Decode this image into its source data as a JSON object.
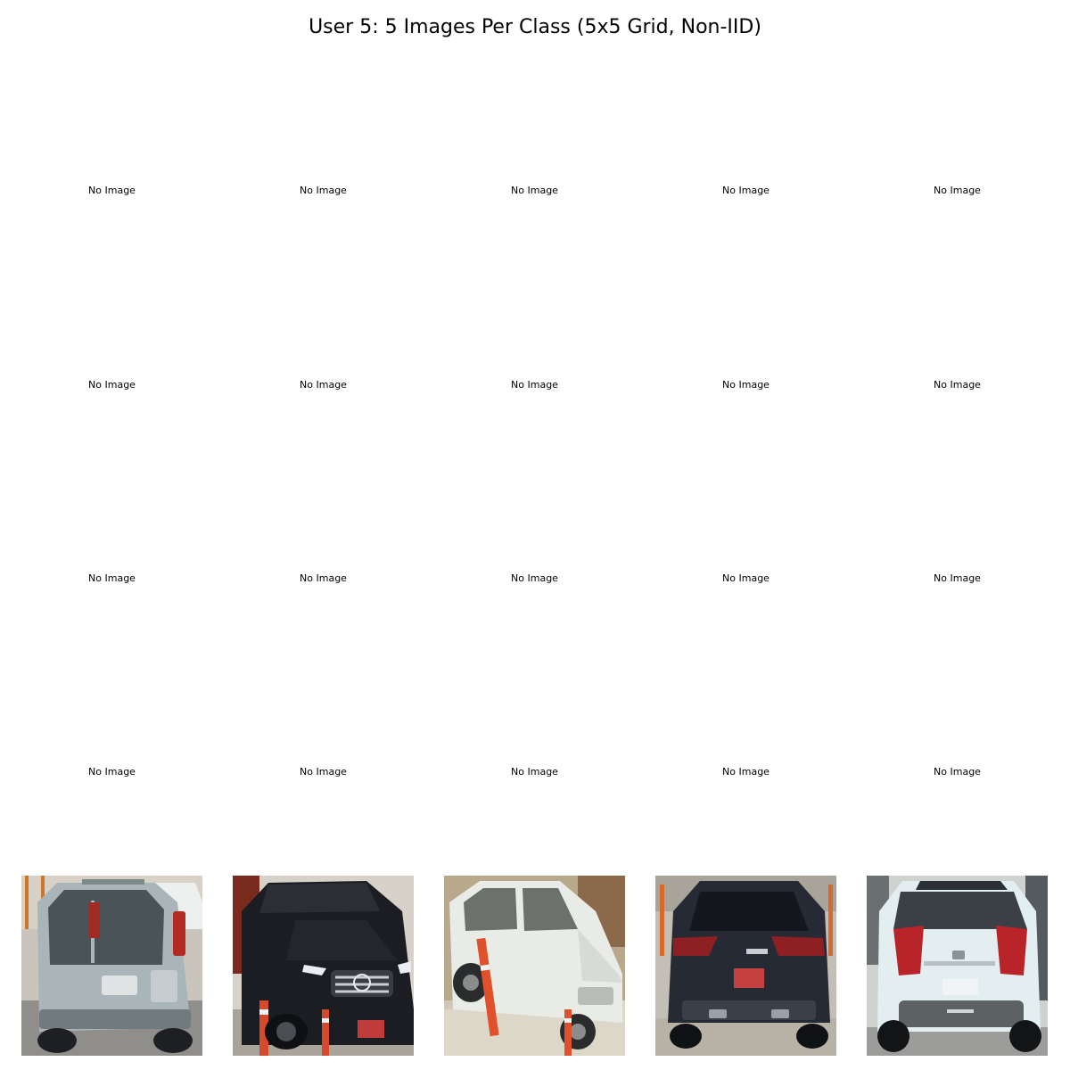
{
  "title": "User 5: 5 Images Per Class (5x5 Grid, Non-IID)",
  "placeholder_label": "No Image",
  "rows": [
    {
      "cells": [
        "No Image",
        "No Image",
        "No Image",
        "No Image",
        "No Image"
      ]
    },
    {
      "cells": [
        "No Image",
        "No Image",
        "No Image",
        "No Image",
        "No Image"
      ]
    },
    {
      "cells": [
        "No Image",
        "No Image",
        "No Image",
        "No Image",
        "No Image"
      ]
    },
    {
      "cells": [
        "No Image",
        "No Image",
        "No Image",
        "No Image",
        "No Image"
      ]
    }
  ],
  "photo_row": [
    {
      "subject": "silver-suv-rear",
      "body_color": "#a9b5b8"
    },
    {
      "subject": "black-suv-front",
      "body_color": "#1c1d22"
    },
    {
      "subject": "white-suv-side",
      "body_color": "#e9ebe6"
    },
    {
      "subject": "dark-suv-rear",
      "body_color": "#252a35"
    },
    {
      "subject": "white-suv-rear",
      "body_color": "#e3eef0"
    }
  ]
}
